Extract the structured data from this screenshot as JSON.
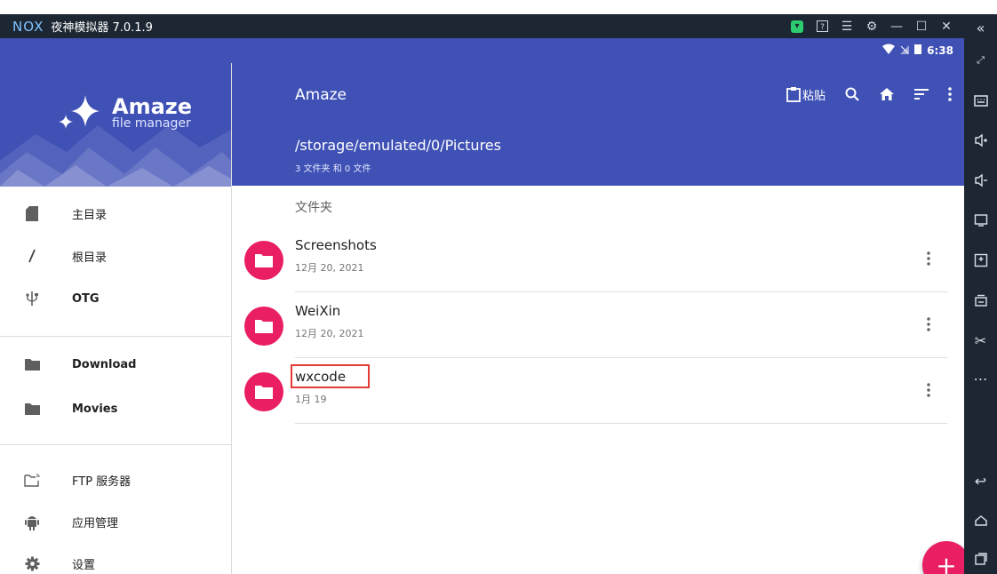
{
  "emulator": {
    "logo": "NOX",
    "title": "夜神模拟器 7.0.1.9"
  },
  "status_bar": {
    "time": "6:38"
  },
  "drawer": {
    "app_name": "Amaze",
    "app_subtitle": "file manager",
    "items": [
      {
        "label": "主目录",
        "icon": "sd-card-icon"
      },
      {
        "label": "根目录",
        "icon": "slash-icon"
      },
      {
        "label": "OTG",
        "icon": "usb-icon"
      },
      {
        "label": "Download",
        "icon": "folder-icon"
      },
      {
        "label": "Movies",
        "icon": "folder-icon"
      },
      {
        "label": "FTP 服务器",
        "icon": "ftp-folder-icon"
      },
      {
        "label": "应用管理",
        "icon": "android-icon"
      },
      {
        "label": "设置",
        "icon": "gear-icon"
      }
    ]
  },
  "appbar": {
    "title": "Amaze",
    "paste_label": "粘贴",
    "path": "/storage/emulated/0/Pictures",
    "summary": "3 文件夹 和 0 文件"
  },
  "content": {
    "section_label": "文件夹",
    "folders": [
      {
        "name": "Screenshots",
        "date": "12月 20, 2021"
      },
      {
        "name": "WeiXin",
        "date": "12月 20, 2021"
      },
      {
        "name": "wxcode",
        "date": "1月 19"
      }
    ]
  },
  "fab": {
    "label": "+"
  },
  "colors": {
    "primary": "#3f51b5",
    "accent": "#e91e63",
    "emulator_chrome": "#1d2733",
    "highlight": "#e53935"
  }
}
